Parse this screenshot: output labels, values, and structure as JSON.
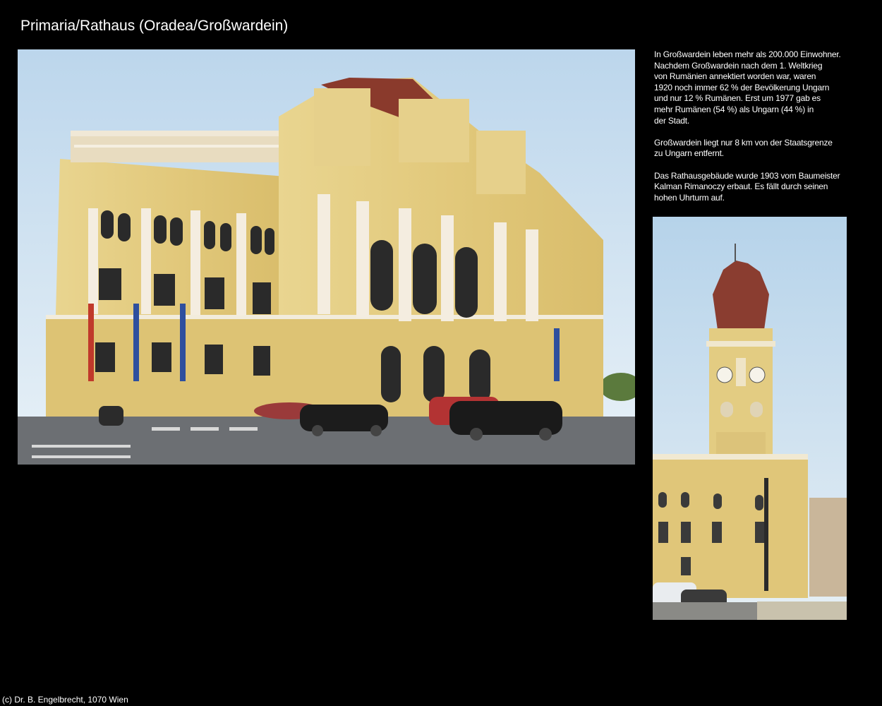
{
  "page": {
    "title": "Primaria/Rathaus (Oradea/Großwardein)",
    "footer": "(c) Dr. B. Engelbrecht, 1070 Wien"
  },
  "description": {
    "paragraphs": [
      {
        "lines": [
          "In Großwardein leben mehr als 200.000 Einwohner.",
          "Nachdem Großwardein nach dem 1. Weltkrieg",
          "von Rumänien annektiert worden war, waren",
          "1920 noch immer 62 % der Bevölkerung Ungarn",
          "und nur 12 % Rumänen. Erst um 1977 gab es",
          "mehr Rumänen (54 %) als Ungarn (44 %) in",
          "der Stadt."
        ]
      },
      {
        "lines": [
          "Großwardein liegt nur 8 km von der Staatsgrenze",
          "zu Ungarn entfernt."
        ]
      },
      {
        "lines": [
          "Das Rathausgebäude wurde 1903 vom Baumeister",
          "Kalman Rimanoczy erbaut. Es fällt durch seinen",
          "hohen Uhrturm auf."
        ]
      }
    ]
  },
  "colors": {
    "background": "#000000",
    "sky": "#cfe2f0",
    "facade": "#e3cc82",
    "roof": "#8a3a2c"
  }
}
